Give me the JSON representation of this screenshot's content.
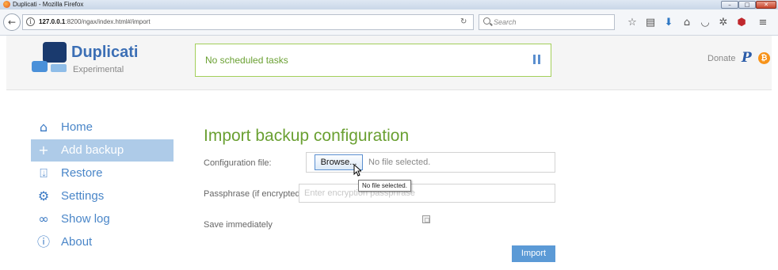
{
  "window": {
    "title": "Duplicati - Mozilla Firefox"
  },
  "browser": {
    "url_host": "127.0.0.1",
    "url_rest": ":8200/ngax/index.html#/import",
    "search_placeholder": "Search"
  },
  "header": {
    "brand_name": "Duplicati",
    "brand_subtitle": "Experimental",
    "status_text": "No scheduled tasks",
    "donate_label": "Donate"
  },
  "sidebar": {
    "items": [
      {
        "label": "Home",
        "icon": "home-icon",
        "active": false
      },
      {
        "label": "Add backup",
        "icon": "plus-icon",
        "active": true
      },
      {
        "label": "Restore",
        "icon": "restore-icon",
        "active": false
      },
      {
        "label": "Settings",
        "icon": "gear-icon",
        "active": false
      },
      {
        "label": "Show log",
        "icon": "voicemail-icon",
        "active": false
      },
      {
        "label": "About",
        "icon": "info-icon",
        "active": false
      }
    ]
  },
  "main": {
    "title": "Import backup configuration",
    "config_file_label": "Configuration file:",
    "browse_label": "Browse...",
    "file_name": "No file selected.",
    "tooltip": "No file selected.",
    "passphrase_label": "Passphrase (if encrypted)",
    "passphrase_placeholder": "Enter encryption passphrase",
    "passphrase_value": "",
    "save_label": "Save immediately",
    "save_checked": false,
    "import_label": "Import"
  },
  "colors": {
    "accent_blue": "#4a86c8",
    "accent_green": "#6aa032",
    "active_nav_bg": "#aecbe8",
    "import_button": "#5b9ad6"
  }
}
